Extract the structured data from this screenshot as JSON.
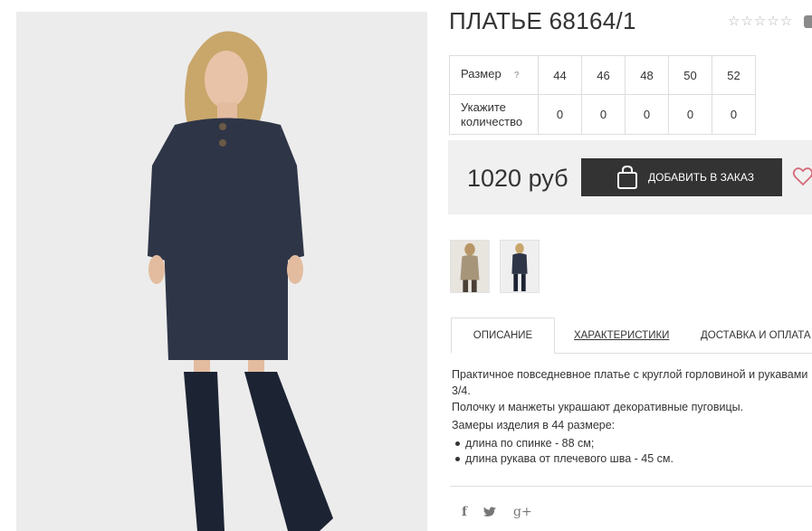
{
  "product": {
    "title": "ПЛАТЬЕ 68164/1",
    "rating_stars": 5,
    "rating_filled": 0
  },
  "sizes": {
    "size_label": "Размер",
    "help_icon": "?",
    "qty_label_line1": "Укажите",
    "qty_label_line2": "количество",
    "values": [
      "44",
      "46",
      "48",
      "50",
      "52"
    ],
    "quantities": [
      "0",
      "0",
      "0",
      "0",
      "0"
    ]
  },
  "purchase": {
    "price": "1020 руб",
    "order_button": "ДОБАВИТЬ В ЗАКАЗ",
    "cart_icon": "shopping-bag-icon",
    "wishlist_icon": "heart-icon"
  },
  "tabs": [
    {
      "label": "ОПИСАНИЕ"
    },
    {
      "label": "ХАРАКТЕРИСТИКИ"
    },
    {
      "label": "ДОСТАВКА И ОПЛАТА"
    }
  ],
  "description": {
    "line1": "Практичное повседневное платье с круглой горловиной и рукавами 3/4.",
    "line2": "Полочку и манжеты украшают декоративные пуговицы.",
    "measures_title": "Замеры изделия в 44 размере:",
    "measures": [
      "длина по спинке - 88 см;",
      "длина рукава от плечевого шва - 45 см."
    ]
  },
  "share": {
    "facebook": "f",
    "twitter": "twitter-icon",
    "google_plus": "g+"
  },
  "colors": {
    "dress": "#2e3547",
    "button_bg": "#333333",
    "price_bar_bg": "#f0f0f0",
    "heart": "#d46a78"
  }
}
